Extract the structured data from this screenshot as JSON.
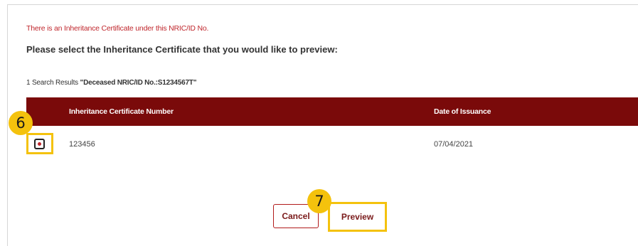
{
  "alert_message": "There is an Inheritance Certificate under this NRIC/ID No.",
  "heading": "Please select the Inheritance Certificate that you would like to preview:",
  "results": {
    "count_text": "1 Search Results",
    "query": "\"Deceased NRIC/ID No.:S1234567T\""
  },
  "table": {
    "columns": [
      "Inheritance Certificate Number",
      "Date of Issuance"
    ],
    "rows": [
      {
        "certificate_number": "123456",
        "date_of_issuance": "07/04/2021",
        "selected": true
      }
    ]
  },
  "annotations": {
    "step_select": "6",
    "step_preview": "7"
  },
  "buttons": {
    "cancel": "Cancel",
    "preview": "Preview"
  },
  "colors": {
    "header_bg": "#7a0a0a",
    "alert_text": "#c0272d",
    "highlight": "#f4c20d",
    "button_text": "#7a1a1a"
  },
  "icons": {
    "row_selector": "radio-selected-icon"
  }
}
